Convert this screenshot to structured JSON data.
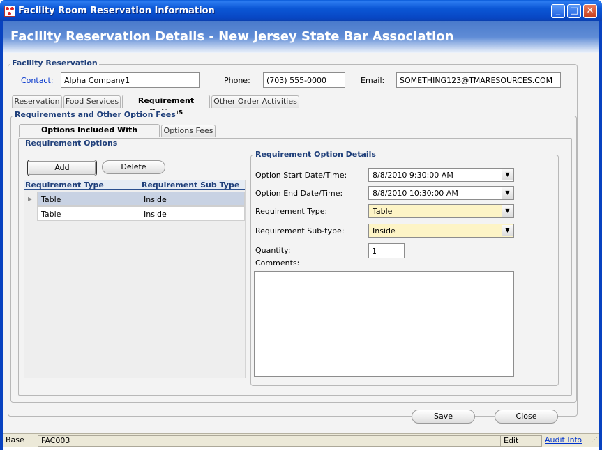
{
  "window": {
    "title": "Facility Room Reservation Information",
    "minimize": "_",
    "maximize": "□",
    "close": "✕"
  },
  "header": {
    "title": "Facility Reservation Details - New Jersey State Bar Association"
  },
  "facility": {
    "group_title": "Facility Reservation",
    "contact_label": "Contact:",
    "contact_value": "Alpha Company1",
    "phone_label": "Phone:",
    "phone_value": "(703) 555-0000",
    "email_label": "Email:",
    "email_value": "SOMETHING123@TMARESOURCES.COM"
  },
  "main_tabs": [
    "Reservation",
    "Food Services",
    "Requirement Options",
    "Other Order Activities"
  ],
  "requirements": {
    "group_title": "Requirements and Other Option Fees",
    "sub_tabs": [
      "Options Included With Reservation",
      "Options Fees"
    ],
    "options_group_title": "Requirement Options",
    "add_label": "Add",
    "delete_label": "Delete",
    "columns": [
      "Requirement Type",
      "Requirement Sub Type"
    ],
    "rows": [
      {
        "type": "Table",
        "sub": "Inside"
      },
      {
        "type": "Table",
        "sub": "Inside"
      }
    ]
  },
  "details": {
    "group_title": "Requirement Option Details",
    "start_label": "Option Start Date/Time:",
    "start_value": "8/8/2010 9:30:00 AM",
    "end_label": "Option End Date/Time:",
    "end_value": "8/8/2010 10:30:00 AM",
    "type_label": "Requirement Type:",
    "type_value": "Table",
    "subtype_label": "Requirement Sub-type:",
    "subtype_value": "Inside",
    "quantity_label": "Quantity:",
    "quantity_value": "1",
    "comments_label": "Comments:",
    "comments_value": ""
  },
  "footer": {
    "save_label": "Save",
    "close_label": "Close"
  },
  "status": {
    "mode": "Base",
    "code": "FAC003",
    "state": "Edit",
    "audit_link": "Audit Info"
  },
  "colors": {
    "titlebar": "#0b57d6",
    "header": "#5f8cd6",
    "accent": "#1f3f7a",
    "required_field": "#fdf4c6"
  },
  "icons": [
    "app-icon",
    "minimize-icon",
    "maximize-icon",
    "close-icon",
    "chevron-down-icon",
    "row-indicator-icon",
    "resize-grip-icon"
  ]
}
